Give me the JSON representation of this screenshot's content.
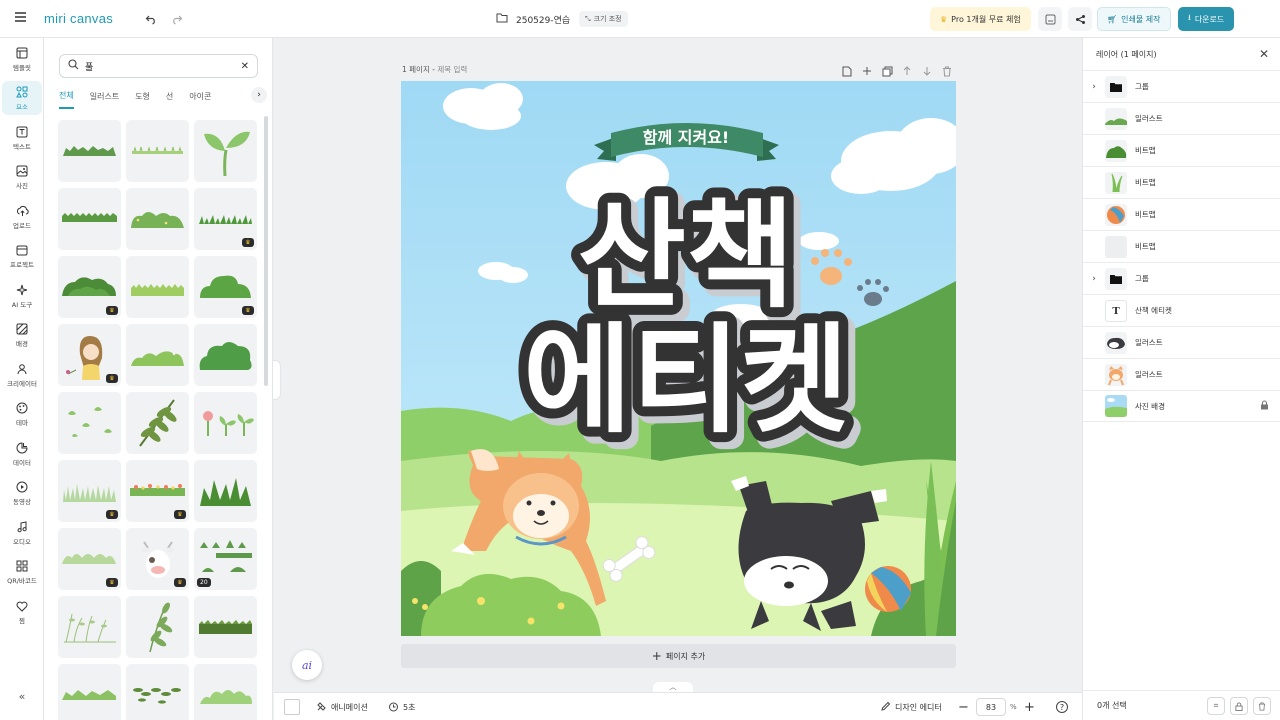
{
  "topbar": {
    "logo": "miri canvas",
    "file_name": "250529-연습",
    "resize_label": "크기 조정",
    "pro_label": "Pro 1개월 무료 체험",
    "print_label": "인쇄물 제작",
    "download_label": "다운로드"
  },
  "rail": [
    {
      "label": "템플릿",
      "icon": "template-icon"
    },
    {
      "label": "요소",
      "icon": "elements-icon"
    },
    {
      "label": "텍스트",
      "icon": "text-icon"
    },
    {
      "label": "사진",
      "icon": "photo-icon"
    },
    {
      "label": "업로드",
      "icon": "upload-icon"
    },
    {
      "label": "프로젝트",
      "icon": "project-icon"
    },
    {
      "label": "AI 도구",
      "icon": "ai-tools-icon"
    },
    {
      "label": "배경",
      "icon": "background-icon"
    },
    {
      "label": "크리에이터",
      "icon": "creator-icon"
    },
    {
      "label": "테마",
      "icon": "theme-icon"
    },
    {
      "label": "데이터",
      "icon": "data-icon"
    },
    {
      "label": "동영상",
      "icon": "video-icon"
    },
    {
      "label": "오디오",
      "icon": "audio-icon"
    },
    {
      "label": "QR/바코드",
      "icon": "qr-icon"
    },
    {
      "label": "찜",
      "icon": "heart-icon"
    }
  ],
  "panel": {
    "search_value": "풀",
    "tabs": [
      "전체",
      "일러스트",
      "도형",
      "선",
      "아이콘"
    ],
    "count_badge": "20"
  },
  "canvas": {
    "page_label": "1 페이지 -",
    "title_placeholder": "제목 입력",
    "banner_text": "함께 지켜요!",
    "headline_line1": "산책",
    "headline_line2": "에티켓",
    "add_page_label": "페이지 추가"
  },
  "bottombar": {
    "animation_label": "애니메이션",
    "duration_label": "5초",
    "design_editor_label": "디자인 에디터",
    "zoom_value": "83",
    "zoom_unit": "%"
  },
  "layers": {
    "title": "레이어 (1 페이지)",
    "items": [
      {
        "name": "그룹",
        "type": "group"
      },
      {
        "name": "일러스트",
        "type": "illust-grass"
      },
      {
        "name": "비트맵",
        "type": "bitmap-bush"
      },
      {
        "name": "비트맵",
        "type": "bitmap-tallgrass"
      },
      {
        "name": "비트맵",
        "type": "bitmap-ball"
      },
      {
        "name": "비트맵",
        "type": "bitmap-blank"
      },
      {
        "name": "그룹",
        "type": "group"
      },
      {
        "name": "산책 에티켓",
        "type": "text"
      },
      {
        "name": "일러스트",
        "type": "illust-husky"
      },
      {
        "name": "일러스트",
        "type": "illust-shiba"
      },
      {
        "name": "사진 배경",
        "type": "photo-bg",
        "locked": true
      }
    ],
    "selected_label": "0개 선택"
  },
  "colors": {
    "accent": "#1d9ab7",
    "sky": "#aee0f6",
    "grass": "#9fd36f",
    "banner": "#3f8a66"
  }
}
